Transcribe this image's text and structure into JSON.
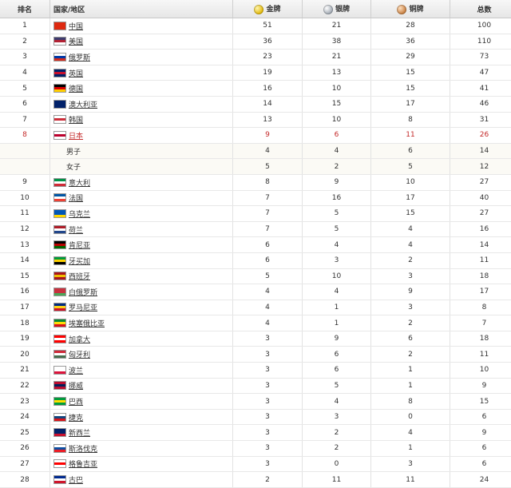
{
  "headers": {
    "rank": "排名",
    "country": "国家/地区",
    "gold": "金牌",
    "silver": "银牌",
    "bronze": "铜牌",
    "total": "总数"
  },
  "colors": {
    "highlight": "#c42a2a",
    "gold_icon": "#e0b400",
    "silver_icon": "#9ea6b0",
    "bronze_icon": "#c47a3a"
  },
  "rows": [
    {
      "rank": "1",
      "name": "中国",
      "gold": "51",
      "silver": "21",
      "bronze": "28",
      "total": "100",
      "flag": [
        "#de2910",
        "#de2910",
        "#de2910"
      ]
    },
    {
      "rank": "2",
      "name": "美国",
      "gold": "36",
      "silver": "38",
      "bronze": "36",
      "total": "110",
      "flag": [
        "#3c3b6e",
        "#b22234",
        "#ffffff"
      ]
    },
    {
      "rank": "3",
      "name": "俄罗斯",
      "gold": "23",
      "silver": "21",
      "bronze": "29",
      "total": "73",
      "flag": [
        "#ffffff",
        "#0039a6",
        "#d52b1e"
      ]
    },
    {
      "rank": "4",
      "name": "英国",
      "gold": "19",
      "silver": "13",
      "bronze": "15",
      "total": "47",
      "flag": [
        "#012169",
        "#c8102e",
        "#012169"
      ]
    },
    {
      "rank": "5",
      "name": "德国",
      "gold": "16",
      "silver": "10",
      "bronze": "15",
      "total": "41",
      "flag": [
        "#000000",
        "#dd0000",
        "#ffce00"
      ]
    },
    {
      "rank": "6",
      "name": "澳大利亚",
      "gold": "14",
      "silver": "15",
      "bronze": "17",
      "total": "46",
      "flag": [
        "#012169",
        "#012169",
        "#012169"
      ]
    },
    {
      "rank": "7",
      "name": "韩国",
      "gold": "13",
      "silver": "10",
      "bronze": "8",
      "total": "31",
      "flag": [
        "#ffffff",
        "#cd2e3a",
        "#ffffff"
      ]
    },
    {
      "rank": "8",
      "name": "日本",
      "gold": "9",
      "silver": "6",
      "bronze": "11",
      "total": "26",
      "flag": [
        "#ffffff",
        "#bc002d",
        "#ffffff"
      ],
      "highlight": true
    },
    {
      "sub": true,
      "name": "男子",
      "gold": "4",
      "silver": "4",
      "bronze": "6",
      "total": "14"
    },
    {
      "sub": true,
      "name": "女子",
      "gold": "5",
      "silver": "2",
      "bronze": "5",
      "total": "12"
    },
    {
      "rank": "9",
      "name": "意大利",
      "gold": "8",
      "silver": "9",
      "bronze": "10",
      "total": "27",
      "flag": [
        "#009246",
        "#ffffff",
        "#ce2b37"
      ]
    },
    {
      "rank": "10",
      "name": "法国",
      "gold": "7",
      "silver": "16",
      "bronze": "17",
      "total": "40",
      "flag": [
        "#0055a4",
        "#ffffff",
        "#ef4135"
      ]
    },
    {
      "rank": "11",
      "name": "乌克兰",
      "gold": "7",
      "silver": "5",
      "bronze": "15",
      "total": "27",
      "flag": [
        "#0057b7",
        "#0057b7",
        "#ffd700"
      ]
    },
    {
      "rank": "12",
      "name": "荷兰",
      "gold": "7",
      "silver": "5",
      "bronze": "4",
      "total": "16",
      "flag": [
        "#ae1c28",
        "#ffffff",
        "#21468b"
      ]
    },
    {
      "rank": "13",
      "name": "肯尼亚",
      "gold": "6",
      "silver": "4",
      "bronze": "4",
      "total": "14",
      "flag": [
        "#000000",
        "#bb0000",
        "#006600"
      ]
    },
    {
      "rank": "14",
      "name": "牙买加",
      "gold": "6",
      "silver": "3",
      "bronze": "2",
      "total": "11",
      "flag": [
        "#009b3a",
        "#fed100",
        "#000000"
      ]
    },
    {
      "rank": "15",
      "name": "西班牙",
      "gold": "5",
      "silver": "10",
      "bronze": "3",
      "total": "18",
      "flag": [
        "#aa151b",
        "#f1bf00",
        "#aa151b"
      ]
    },
    {
      "rank": "16",
      "name": "白俄罗斯",
      "gold": "4",
      "silver": "4",
      "bronze": "9",
      "total": "17",
      "flag": [
        "#c8313e",
        "#c8313e",
        "#4aa657"
      ]
    },
    {
      "rank": "17",
      "name": "罗马尼亚",
      "gold": "4",
      "silver": "1",
      "bronze": "3",
      "total": "8",
      "flag": [
        "#002b7f",
        "#fcd116",
        "#ce1126"
      ]
    },
    {
      "rank": "18",
      "name": "埃塞俄比亚",
      "gold": "4",
      "silver": "1",
      "bronze": "2",
      "total": "7",
      "flag": [
        "#078930",
        "#fcdd09",
        "#da121a"
      ]
    },
    {
      "rank": "19",
      "name": "加拿大",
      "gold": "3",
      "silver": "9",
      "bronze": "6",
      "total": "18",
      "flag": [
        "#ff0000",
        "#ffffff",
        "#ff0000"
      ]
    },
    {
      "rank": "20",
      "name": "匈牙利",
      "gold": "3",
      "silver": "6",
      "bronze": "2",
      "total": "11",
      "flag": [
        "#ce2939",
        "#ffffff",
        "#477050"
      ]
    },
    {
      "rank": "21",
      "name": "波兰",
      "gold": "3",
      "silver": "6",
      "bronze": "1",
      "total": "10",
      "flag": [
        "#ffffff",
        "#ffffff",
        "#dc143c"
      ]
    },
    {
      "rank": "22",
      "name": "挪威",
      "gold": "3",
      "silver": "5",
      "bronze": "1",
      "total": "9",
      "flag": [
        "#ba0c2f",
        "#00205b",
        "#ba0c2f"
      ]
    },
    {
      "rank": "23",
      "name": "巴西",
      "gold": "3",
      "silver": "4",
      "bronze": "8",
      "total": "15",
      "flag": [
        "#009c3b",
        "#ffdf00",
        "#009c3b"
      ]
    },
    {
      "rank": "24",
      "name": "捷克",
      "gold": "3",
      "silver": "3",
      "bronze": "0",
      "total": "6",
      "flag": [
        "#ffffff",
        "#11457e",
        "#d7141a"
      ]
    },
    {
      "rank": "25",
      "name": "新西兰",
      "gold": "3",
      "silver": "2",
      "bronze": "4",
      "total": "9",
      "flag": [
        "#012169",
        "#012169",
        "#c8102e"
      ]
    },
    {
      "rank": "26",
      "name": "斯洛伐克",
      "gold": "3",
      "silver": "2",
      "bronze": "1",
      "total": "6",
      "flag": [
        "#ffffff",
        "#0b4ea2",
        "#ee1c25"
      ]
    },
    {
      "rank": "27",
      "name": "格鲁吉亚",
      "gold": "3",
      "silver": "0",
      "bronze": "3",
      "total": "6",
      "flag": [
        "#ffffff",
        "#ff0000",
        "#ffffff"
      ]
    },
    {
      "rank": "28",
      "name": "古巴",
      "gold": "2",
      "silver": "11",
      "bronze": "11",
      "total": "24",
      "flag": [
        "#002a8f",
        "#ffffff",
        "#cf142b"
      ]
    }
  ]
}
